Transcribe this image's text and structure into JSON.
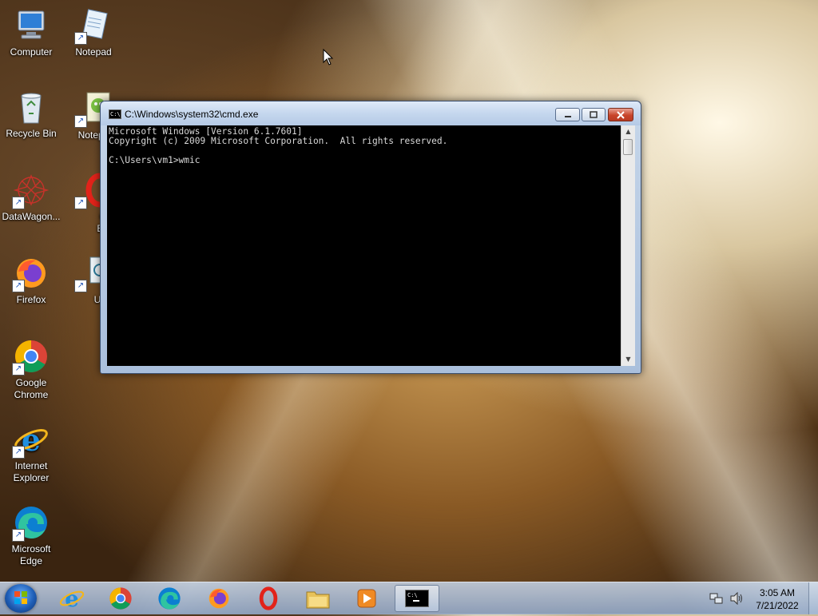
{
  "desktop": {
    "icons": [
      {
        "label": "Computer",
        "icon": "computer-icon"
      },
      {
        "label": "Notepad",
        "icon": "notepad-icon"
      },
      {
        "label": "Recycle Bin",
        "icon": "recycle-bin-icon"
      },
      {
        "label": "Notepa",
        "icon": "notepad-plus-icon"
      },
      {
        "label": "DataWagon...",
        "icon": "datawagon-icon"
      },
      {
        "label": "Oper Brows",
        "icon": "opera-icon"
      },
      {
        "label": "Firefox",
        "icon": "firefox-icon"
      },
      {
        "label": "Upda",
        "icon": "update-icon"
      },
      {
        "label": "Google Chrome",
        "icon": "chrome-icon"
      },
      {
        "label": "Internet Explorer",
        "icon": "ie-icon"
      },
      {
        "label": "Microsoft Edge",
        "icon": "edge-icon"
      }
    ]
  },
  "cmd": {
    "title": "C:\\Windows\\system32\\cmd.exe",
    "app_icon_text": "C:\\",
    "output": "Microsoft Windows [Version 6.1.7601]\nCopyright (c) 2009 Microsoft Corporation.  All rights reserved.\n\nC:\\Users\\vm1>wmic"
  },
  "taskbar": {
    "apps": [
      {
        "name": "Internet Explorer",
        "icon": "ie-icon"
      },
      {
        "name": "Google Chrome",
        "icon": "chrome-icon"
      },
      {
        "name": "Microsoft Edge",
        "icon": "edge-icon"
      },
      {
        "name": "Firefox",
        "icon": "firefox-icon"
      },
      {
        "name": "Opera",
        "icon": "opera-icon"
      },
      {
        "name": "Windows Explorer",
        "icon": "folder-icon"
      },
      {
        "name": "Windows Media Player",
        "icon": "media-player-icon"
      },
      {
        "name": "Command Prompt",
        "icon": "cmd-icon"
      }
    ],
    "time": "3:05 AM",
    "date": "7/21/2022"
  }
}
